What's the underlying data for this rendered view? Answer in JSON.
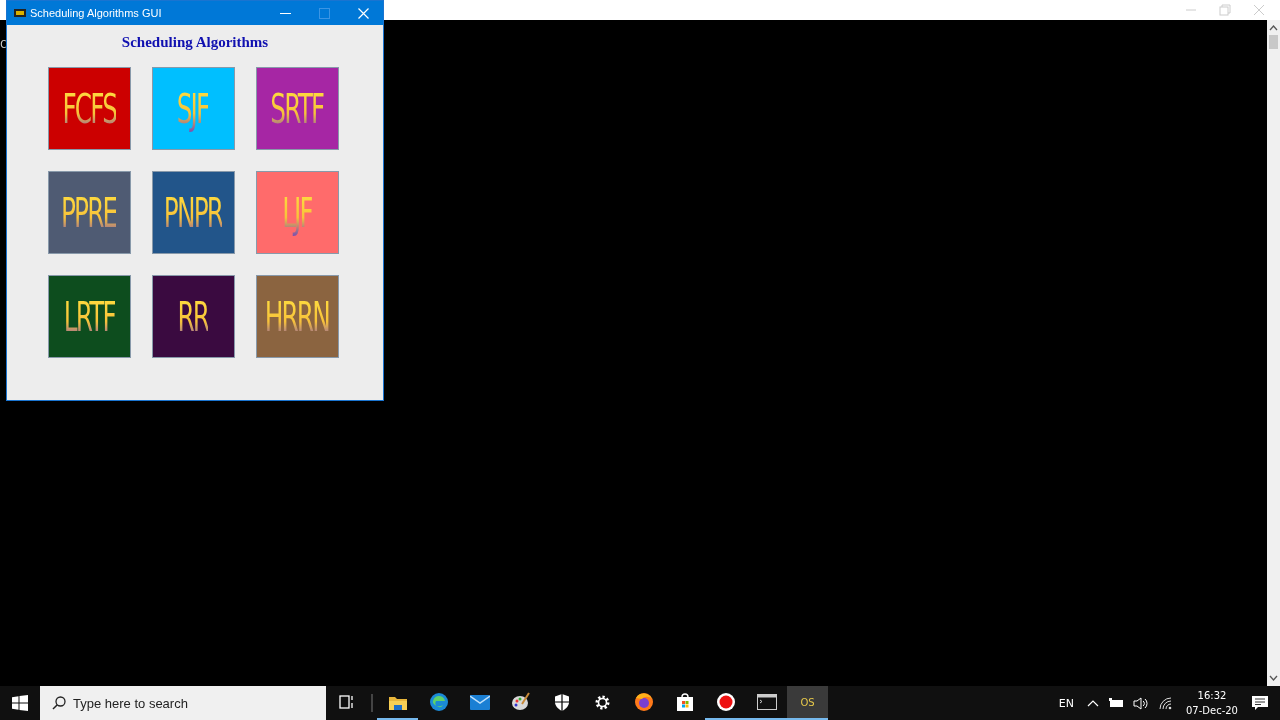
{
  "console": {
    "text": "C"
  },
  "window": {
    "title": "Scheduling Algorithms GUI",
    "heading": "Scheduling Algorithms",
    "tiles": [
      {
        "label": "FCFS",
        "color": "#cc0000"
      },
      {
        "label": "SJF",
        "color": "#00bfff"
      },
      {
        "label": "SRTF",
        "color": "#a626a4"
      },
      {
        "label": "PPRE",
        "color": "#4f5b73"
      },
      {
        "label": "PNPR",
        "color": "#22558a"
      },
      {
        "label": "LJF",
        "color": "#ff6b6b"
      },
      {
        "label": "LRTF",
        "color": "#0d4d1e"
      },
      {
        "label": "RR",
        "color": "#3a0a40"
      },
      {
        "label": "HRRN",
        "color": "#8b6440"
      }
    ]
  },
  "taskbar": {
    "search": {
      "placeholder": "Type here to search"
    },
    "apps": [
      {
        "kind": "taskview",
        "running": false,
        "selected": false
      },
      {
        "kind": "folder",
        "running": true,
        "selected": false
      },
      {
        "kind": "browser",
        "running": false,
        "selected": false
      },
      {
        "kind": "mail",
        "running": false,
        "selected": false
      },
      {
        "kind": "paint",
        "running": false,
        "selected": false
      },
      {
        "kind": "shield",
        "running": false,
        "selected": false
      },
      {
        "kind": "gear",
        "running": false,
        "selected": false
      },
      {
        "kind": "firefox",
        "running": false,
        "selected": false
      },
      {
        "kind": "store",
        "running": false,
        "selected": false
      },
      {
        "kind": "record",
        "running": true,
        "selected": false
      },
      {
        "kind": "terminal",
        "running": true,
        "selected": false
      },
      {
        "kind": "text",
        "label": "OS",
        "running": true,
        "selected": true
      }
    ],
    "language": "EN",
    "time": "16:32",
    "date": "07-Dec-20"
  }
}
